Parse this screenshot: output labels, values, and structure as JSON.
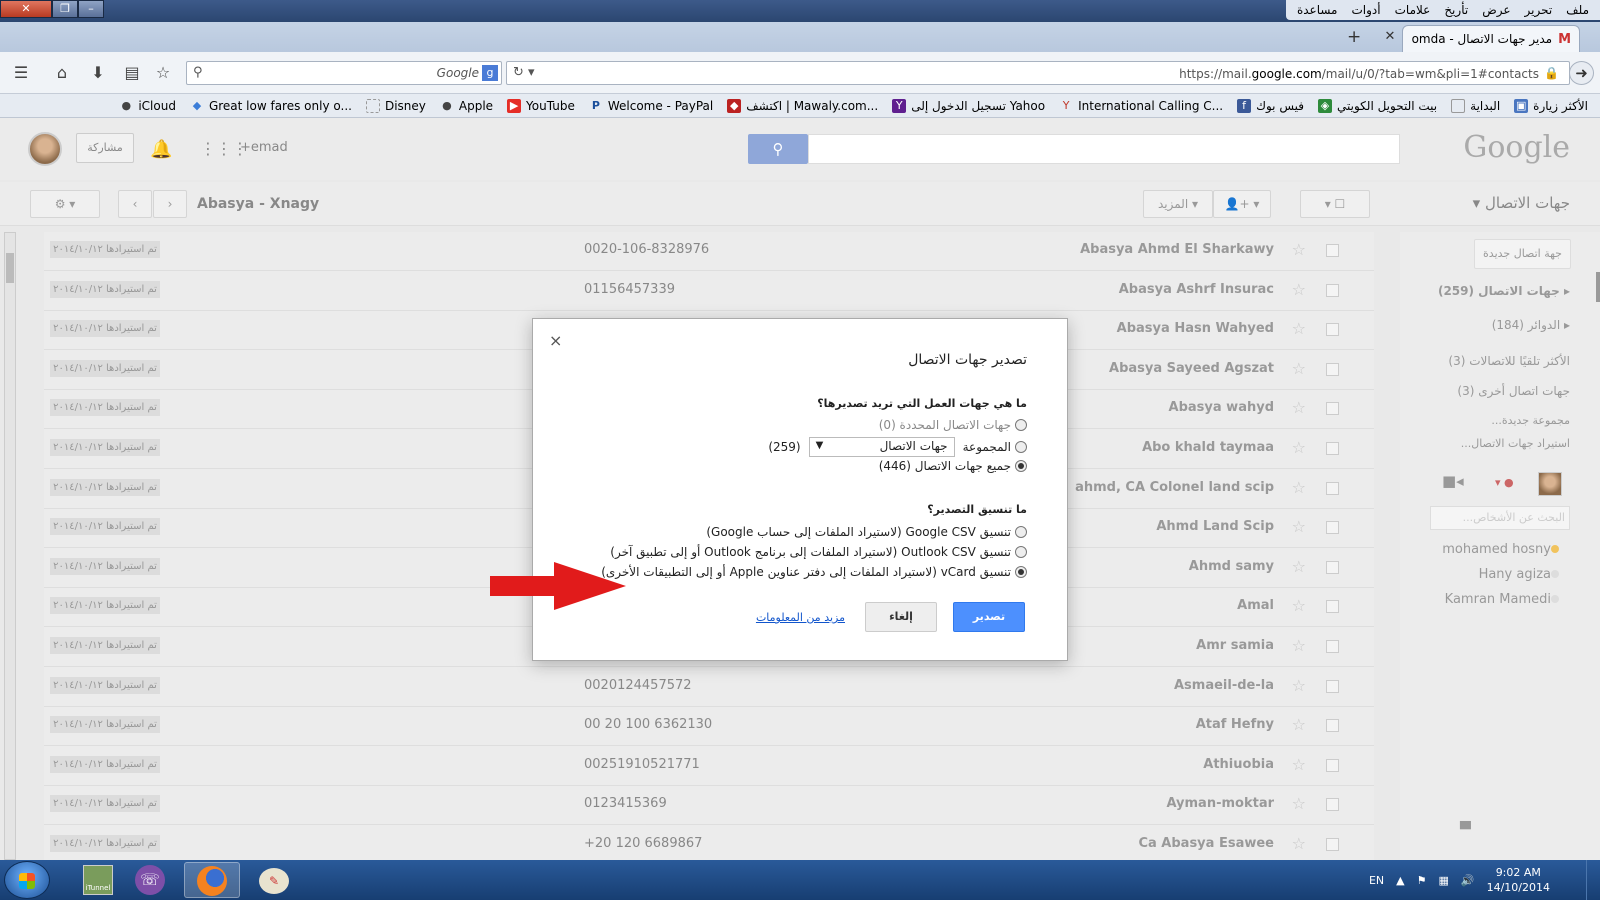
{
  "browser": {
    "menu": [
      "ملف",
      "تحرير",
      "عرض",
      "تأريخ",
      "علامات",
      "أدوات",
      "مساعدة"
    ],
    "tab_title": "مدير جهات الاتصال - omda...",
    "search_engine": "Google",
    "url_prefix": "https://mail.",
    "url_domain": "google.com",
    "url_suffix": "/mail/u/0/?tab=wm&pli=1#contacts",
    "bookmarks": [
      "الأكثر زيارة",
      "البداية",
      "بيت التحويل الكويتي",
      "فيس بوك",
      "International Calling C...",
      "تسجيل الدخول إلى Yahoo",
      "اكتشف | Mawaly.com...",
      "Welcome - PayPal",
      "YouTube",
      "Apple",
      "Disney",
      "Great low fares only o...",
      "iCloud"
    ]
  },
  "gmail": {
    "share_label": "مشاركة",
    "user_label": "+emad",
    "logo": "Google",
    "toolbar": {
      "title": "Abasya - Xnagy",
      "more_label": "المزيد",
      "section_label": "جهات الاتصال"
    }
  },
  "contacts": [
    {
      "name": "Abasya Ahmd El Sharkawy",
      "phone": "0020-106-8328976",
      "date": "تم استيرادها ٢٠١٤/١٠/١٢"
    },
    {
      "name": "Abasya Ashrf Insurac",
      "phone": "01156457339",
      "date": "تم استيرادها ٢٠١٤/١٠/١٢"
    },
    {
      "name": "Abasya Hasn Wahyed",
      "phone": "",
      "date": "تم استيرادها ٢٠١٤/١٠/١٢"
    },
    {
      "name": "Abasya Sayeed Agszat",
      "phone": "",
      "date": "تم استيرادها ٢٠١٤/١٠/١٢"
    },
    {
      "name": "Abasya wahyd",
      "phone": "",
      "date": "تم استيرادها ٢٠١٤/١٠/١٢"
    },
    {
      "name": "Abo khald taymaa",
      "phone": "",
      "date": "تم استيرادها ٢٠١٤/١٠/١٢"
    },
    {
      "name": "ahmd, CA Colonel land scip",
      "phone": "",
      "date": "تم استيرادها ٢٠١٤/١٠/١٢"
    },
    {
      "name": "Ahmd Land Scip",
      "phone": "",
      "date": "تم استيرادها ٢٠١٤/١٠/١٢"
    },
    {
      "name": "Ahmd samy",
      "phone": "",
      "date": "تم استيرادها ٢٠١٤/١٠/١٢"
    },
    {
      "name": "Amal",
      "phone": "",
      "date": "تم استيرادها ٢٠١٤/١٠/١٢"
    },
    {
      "name": "Amr samia",
      "phone": "",
      "date": "تم استيرادها ٢٠١٤/١٠/١٢"
    },
    {
      "name": "Asmaeil-de-la",
      "phone": "0020124457572",
      "date": "تم استيرادها ٢٠١٤/١٠/١٢"
    },
    {
      "name": "Ataf Hefny",
      "phone": "00 20 100 6362130",
      "date": "تم استيرادها ٢٠١٤/١٠/١٢"
    },
    {
      "name": "Athiuobia",
      "phone": "00251910521771",
      "date": "تم استيرادها ٢٠١٤/١٠/١٢"
    },
    {
      "name": "Ayman-moktar",
      "phone": "0123415369",
      "date": "تم استيرادها ٢٠١٤/١٠/١٢"
    },
    {
      "name": "Ca Abasya Esawee",
      "phone": "+20 120 6689867",
      "date": "تم استيرادها ٢٠١٤/١٠/١٢"
    }
  ],
  "sidebar": {
    "new_contact": "جهة اتصال جديدة",
    "items": [
      {
        "label": "جهات الاتصال (259)",
        "bold": true
      },
      {
        "label": "الدوائر (184)",
        "bold": false
      },
      {
        "label": "الأكثر تلقيًا للاتصالات (3)",
        "bold": false
      },
      {
        "label": "جهات اتصال أخرى (3)",
        "bold": false
      },
      {
        "label": "مجموعة جديدة...",
        "bold": false
      },
      {
        "label": "استيراد جهات الاتصال...",
        "bold": false
      }
    ],
    "chat_search_placeholder": "البحث عن الأشخاص...",
    "people": [
      "mohamed hosny",
      "Hany agiza",
      "Kamran Mamedi"
    ]
  },
  "dialog": {
    "title": "تصدير جهات الاتصال",
    "q1": "ما هي جهات العمل التي تريد تصديرها؟",
    "opt_selected": "جهات الاتصال المحددة (0)",
    "opt_group": "المجموعة",
    "group_value": "جهات الاتصال",
    "group_count": "(259)",
    "opt_all": "جميع جهات الاتصال (446)",
    "q2": "ما تنسيق التصدير؟",
    "fmt_google": "تنسيق Google CSV (لاستيراد الملفات إلى حساب Google)",
    "fmt_outlook": "تنسيق Outlook CSV (لاستيراد الملفات إلى برنامج Outlook أو إلى تطبيق آخر)",
    "fmt_vcard": "تنسيق vCard (لاستيراد الملفات إلى دفتر عناوين Apple أو إلى التطبيقات الأخرى)",
    "export_label": "تصدير",
    "cancel_label": "إلغاء",
    "more_info": "مزيد من المعلومات",
    "close_glyph": "×"
  },
  "taskbar": {
    "lang": "EN",
    "time": "9:02 AM",
    "date": "14/10/2014",
    "tunnel_label": "iTunnel"
  },
  "colors": {
    "export_button": "#4d90fe",
    "arrow": "#e11b1b",
    "link": "#1155cc"
  }
}
